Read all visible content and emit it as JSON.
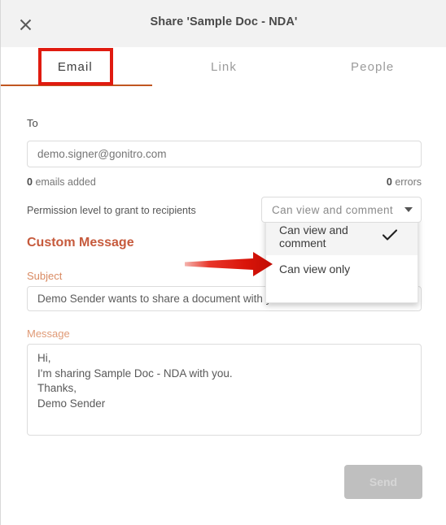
{
  "header": {
    "title": "Share 'Sample Doc - NDA'",
    "close_icon": "close-icon"
  },
  "tabs": [
    {
      "label": "Email",
      "active": true
    },
    {
      "label": "Link",
      "active": false
    },
    {
      "label": "People",
      "active": false
    }
  ],
  "form": {
    "to_label": "To",
    "to_value": "demo.signer@gonitro.com",
    "to_placeholder": "demo.signer@gonitro.com",
    "emails_added_count": "0",
    "emails_added_text": "emails added",
    "errors_count": "0",
    "errors_text": "errors",
    "permission_label": "Permission level to grant to recipients",
    "custom_message_heading": "Custom Message",
    "subject_label": "Subject",
    "subject_value": "Demo Sender wants to share a document with you",
    "message_label": "Message",
    "message_value": "Hi,\nI'm sharing Sample Doc - NDA with you.\nThanks,\nDemo Sender",
    "send_label": "Send"
  },
  "permission_dropdown": {
    "selected_value": "Can view and comment",
    "caret_icon": "chevron-down-icon",
    "check_icon": "check-icon",
    "check_glyph": "✔",
    "options": [
      {
        "label": "Can view and comment",
        "selected": true
      },
      {
        "label": "Can view only",
        "selected": false
      }
    ]
  },
  "annotation": {
    "arrow_icon": "arrow-right-annotation",
    "highlight_target": "Email",
    "colors": {
      "highlight_box": "#e01b10",
      "arrow": "#e01b10"
    }
  },
  "colors": {
    "accent_orange": "#c05621",
    "heading_orange": "#c65a3c",
    "header_bg": "#f2f2f2",
    "send_disabled_bg": "#bfbfbf"
  }
}
